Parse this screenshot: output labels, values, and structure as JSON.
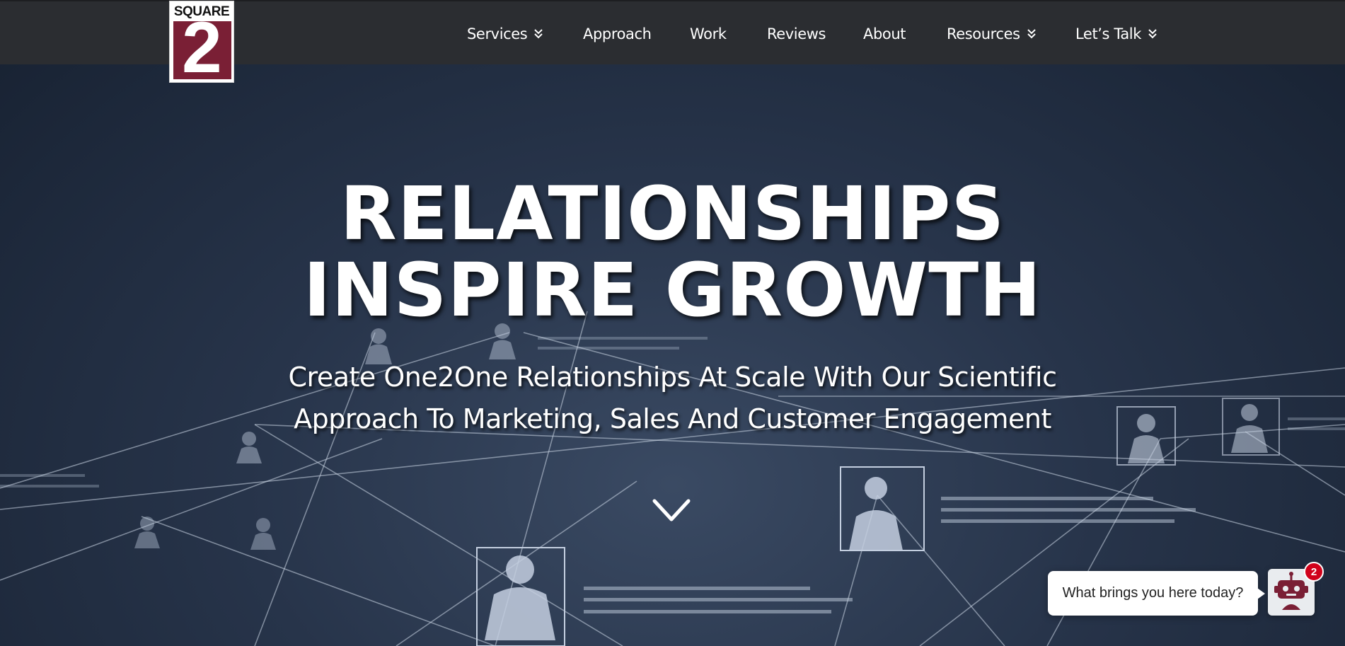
{
  "logo": {
    "text": "SQUARE",
    "digit": "2"
  },
  "nav": {
    "items": [
      {
        "label": "Services",
        "has_dropdown": true
      },
      {
        "label": "Approach",
        "has_dropdown": false
      },
      {
        "label": "Work",
        "has_dropdown": false
      },
      {
        "label": "Reviews",
        "has_dropdown": false
      },
      {
        "label": "About",
        "has_dropdown": false
      },
      {
        "label": "Resources",
        "has_dropdown": true
      },
      {
        "label": "Let’s Talk",
        "has_dropdown": true
      }
    ]
  },
  "hero": {
    "headline_line1": "RELATIONSHIPS",
    "headline_line2": "INSPIRE GROWTH",
    "subheadline_line1": "Create One2One Relationships At Scale With Our Scientific",
    "subheadline_line2": "Approach To Marketing, Sales And Customer Engagement",
    "scroll_icon": "chevron-down-icon"
  },
  "chat": {
    "prompt": "What brings you here today?",
    "badge_count": "2",
    "icon": "robot-icon"
  },
  "colors": {
    "header_bg": "#2b2d31",
    "brand": "#7a1f35",
    "badge": "#d0021b",
    "hero_bg": "#1c2738"
  }
}
